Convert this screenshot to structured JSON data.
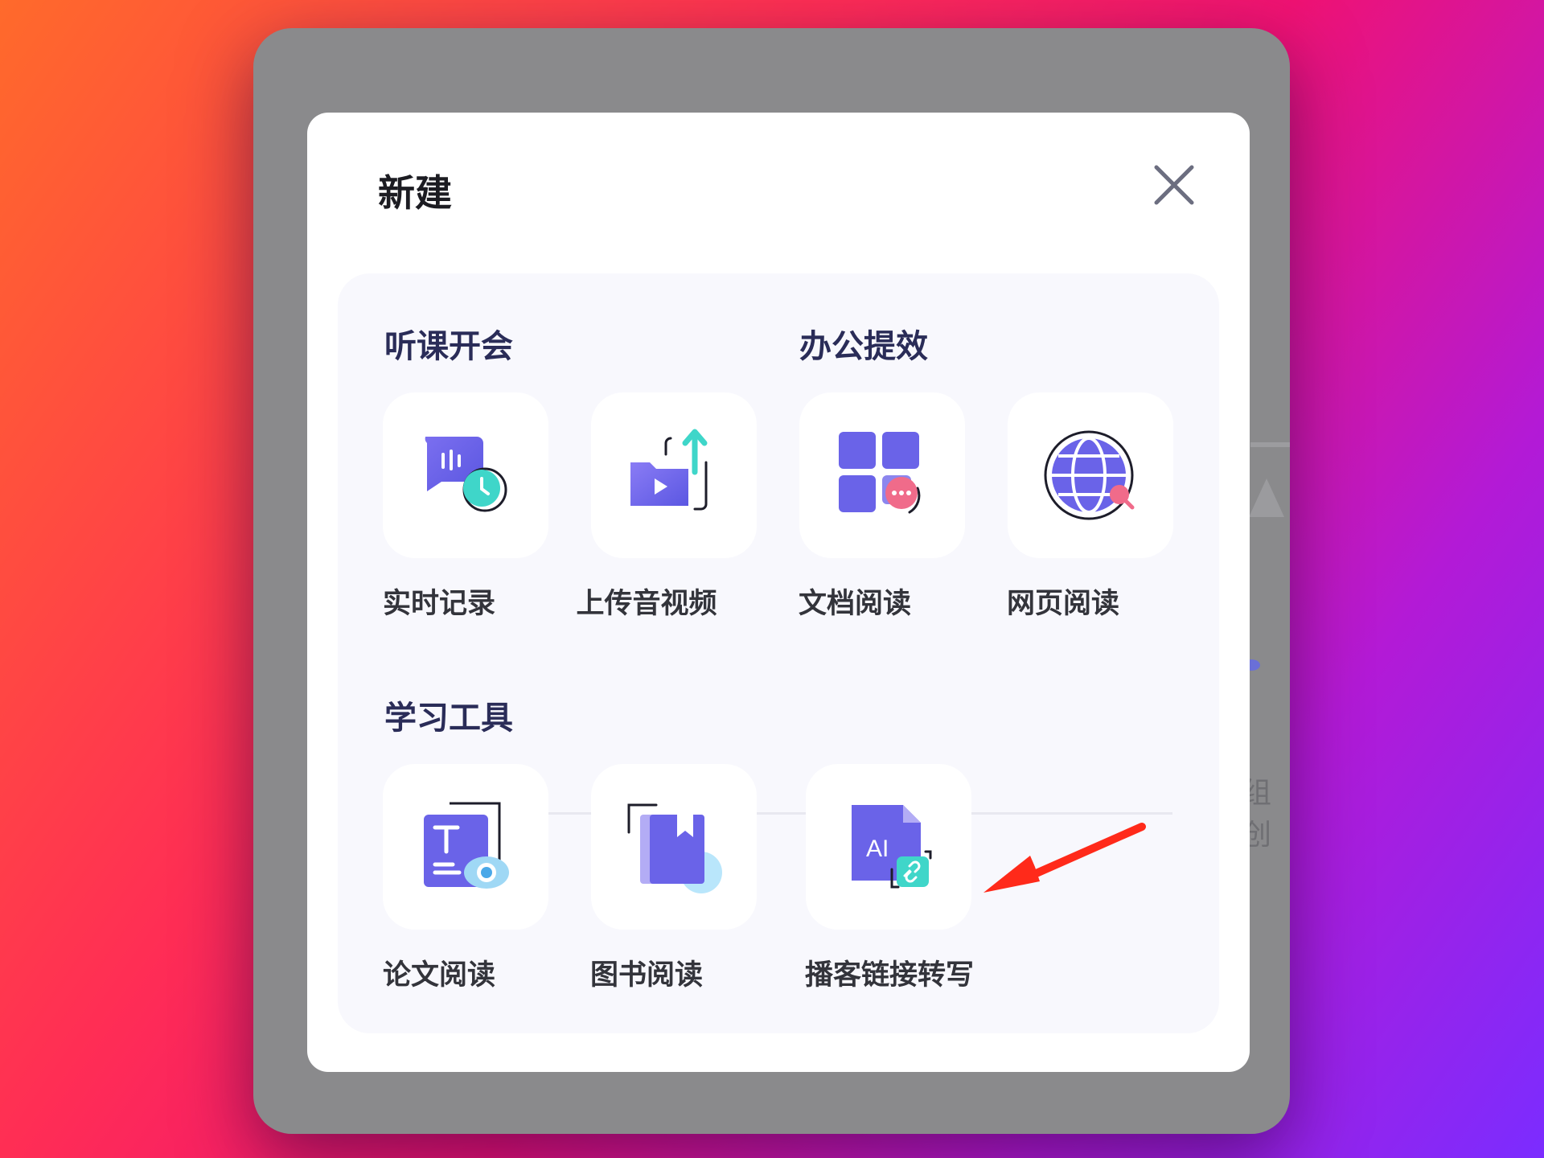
{
  "background_window": {
    "hint_text": "组创"
  },
  "dialog": {
    "title": "新建",
    "close_icon": "close-icon",
    "sections": [
      {
        "title": "听课开会",
        "items": [
          {
            "label": "实时记录",
            "icon": "realtime-record-icon"
          },
          {
            "label": "上传音视频",
            "icon": "upload-av-icon"
          }
        ]
      },
      {
        "title": "办公提效",
        "items": [
          {
            "label": "文档阅读",
            "icon": "doc-read-icon"
          },
          {
            "label": "网页阅读",
            "icon": "web-read-icon"
          }
        ]
      },
      {
        "title": "学习工具",
        "items": [
          {
            "label": "论文阅读",
            "icon": "paper-read-icon"
          },
          {
            "label": "图书阅读",
            "icon": "book-read-icon"
          },
          {
            "label": "播客链接转写",
            "icon": "podcast-link-transcribe-icon"
          }
        ]
      }
    ]
  },
  "annotation": {
    "arrow": "red-arrow",
    "color": "#ff2a1a"
  },
  "colors": {
    "accent_purple": "#6a63e8",
    "accent_teal": "#3fd6c9",
    "accent_pink": "#f06b8a"
  }
}
